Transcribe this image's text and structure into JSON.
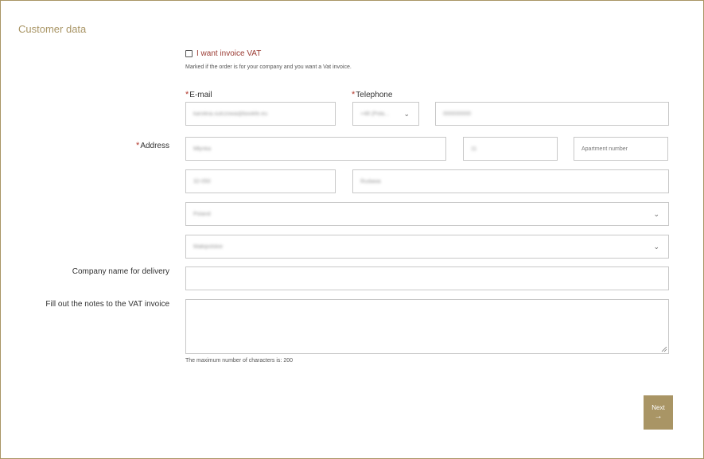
{
  "section": {
    "title": "Customer data"
  },
  "vat": {
    "label": "I want invoice VAT",
    "help": "Marked if the order is for your company and you want a Vat invoice.",
    "checked": false
  },
  "email": {
    "label": "E-mail",
    "value": "karolina.sulczowa@bookfe.eu"
  },
  "telephone": {
    "label": "Telephone",
    "prefix": "+48 (Pola...",
    "value": "000000000"
  },
  "address": {
    "label": "Address",
    "street": "Młynka",
    "number": "11",
    "apartment_placeholder": "Apartment number",
    "postcode": "32-050",
    "city": "Rudawa",
    "country": "Poland",
    "region": "Małopolskie"
  },
  "company": {
    "label": "Company name for delivery",
    "value": ""
  },
  "notes": {
    "label": "Fill out the notes to the VAT invoice",
    "counter": "The maximum number of characters is: 200"
  },
  "next": {
    "label": "Next",
    "arrow": "→"
  },
  "colors": {
    "accent": "#a99565",
    "required": "#b33a2e",
    "vat_label": "#9a3a32"
  },
  "icons": {
    "chevron": "chevron-down-icon",
    "arrow": "arrow-right-icon",
    "checkbox": "checkbox-icon"
  }
}
